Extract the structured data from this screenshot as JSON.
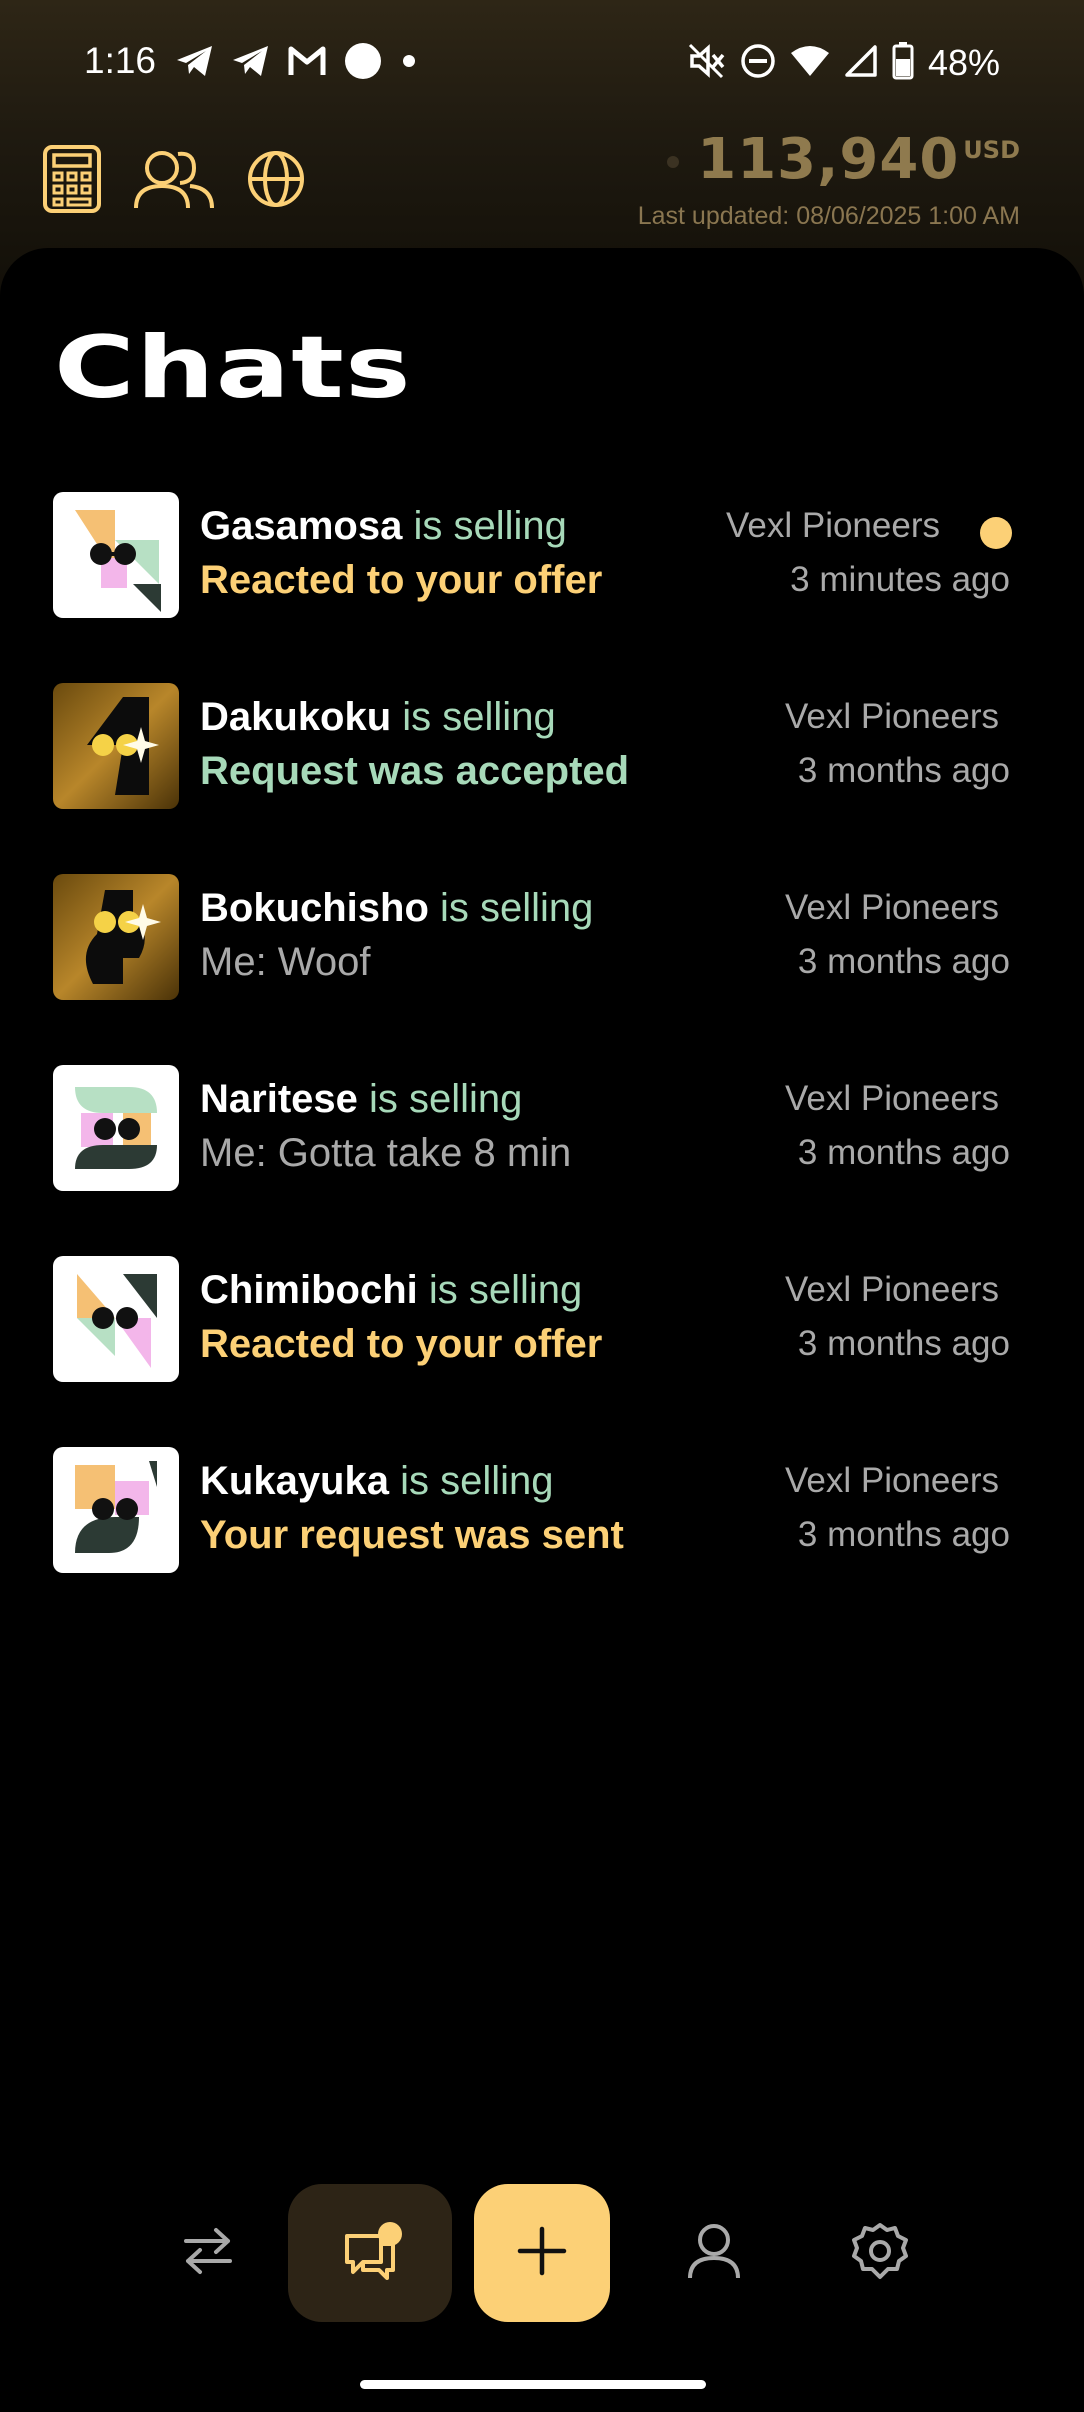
{
  "status_bar": {
    "time": "1:16",
    "battery": "48%",
    "left_icons": [
      "telegram-icon",
      "telegram-icon",
      "gmail-icon",
      "circle-icon",
      "dot-icon"
    ],
    "right_icons": [
      "mute-icon",
      "do-not-disturb-icon",
      "wifi-icon",
      "signal-icon",
      "battery-icon"
    ]
  },
  "header": {
    "icons": [
      "calculator-icon",
      "contacts-icon",
      "globe-icon"
    ],
    "balance": {
      "amount": "113,940",
      "currency": "USD",
      "updated": "Last updated: 08/06/2025 1:00 AM"
    }
  },
  "page": {
    "title": "Chats"
  },
  "chats": [
    {
      "name": "Gasamosa",
      "role": " is selling",
      "message": "Reacted to your offer",
      "message_style": "yellow",
      "club": "Vexl Pioneers",
      "time": "3 minutes ago",
      "unread": true
    },
    {
      "name": "Dakukoku",
      "role": " is selling",
      "message": "Request was accepted",
      "message_style": "green",
      "club": "Vexl Pioneers",
      "time": "3 months ago",
      "unread": false
    },
    {
      "name": "Bokuchisho",
      "role": " is selling",
      "message": "Me: Woof",
      "message_style": "gray",
      "club": "Vexl Pioneers",
      "time": "3 months ago",
      "unread": false
    },
    {
      "name": "Naritese",
      "role": " is selling",
      "message": "Me: Gotta take 8 min",
      "message_style": "gray",
      "club": "Vexl Pioneers",
      "time": "3 months ago",
      "unread": false
    },
    {
      "name": "Chimibochi",
      "role": " is selling",
      "message": "Reacted to your offer",
      "message_style": "yellow",
      "club": "Vexl Pioneers",
      "time": "3 months ago",
      "unread": false
    },
    {
      "name": "Kukayuka",
      "role": " is selling",
      "message": "Your request was sent",
      "message_style": "yellow",
      "club": "Vexl Pioneers",
      "time": "3 months ago",
      "unread": false
    }
  ],
  "bottom_nav": {
    "items": [
      "swap-icon",
      "chats-icon",
      "plus-icon",
      "profile-icon",
      "settings-icon"
    ],
    "active": "chats-icon"
  },
  "colors": {
    "accent_yellow": "#fcd076",
    "accent_green": "#a7d9b9",
    "muted_gray": "#a9a9a9",
    "balance_gold": "#8f7a4e"
  }
}
